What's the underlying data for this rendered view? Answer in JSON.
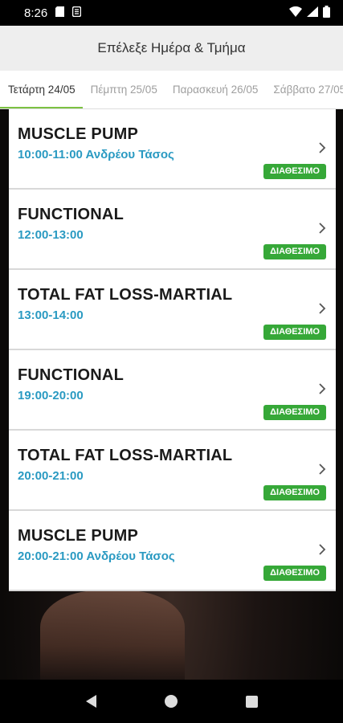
{
  "status_bar": {
    "time": "8:26",
    "icons": [
      "sd-card-icon",
      "sync-icon",
      "wifi-icon",
      "signal-icon",
      "battery-icon"
    ]
  },
  "header": {
    "title": "Επέλεξε Ημέρα & Τμήμα"
  },
  "tabs": [
    {
      "label": "Τετάρτη 24/05",
      "active": true
    },
    {
      "label": "Πέμπτη 25/05",
      "active": false
    },
    {
      "label": "Παρασκευή 26/05",
      "active": false
    },
    {
      "label": "Σάββατο 27/05",
      "active": false
    }
  ],
  "classes": [
    {
      "title": "MUSCLE PUMP",
      "details": "10:00-11:00 Ανδρέου Τάσος",
      "status": "ΔΙΑΘΕΣΙΜΟ"
    },
    {
      "title": "FUNCTIONAL",
      "details": "12:00-13:00",
      "status": "ΔΙΑΘΕΣΙΜΟ"
    },
    {
      "title": "TOTAL FAT LOSS-MARTIAL",
      "details": "13:00-14:00",
      "status": "ΔΙΑΘΕΣΙΜΟ"
    },
    {
      "title": "FUNCTIONAL",
      "details": "19:00-20:00",
      "status": "ΔΙΑΘΕΣΙΜΟ"
    },
    {
      "title": "TOTAL FAT LOSS-MARTIAL",
      "details": "20:00-21:00",
      "status": "ΔΙΑΘΕΣΙΜΟ"
    },
    {
      "title": "MUSCLE PUMP",
      "details": "20:00-21:00 Ανδρέου Τάσος",
      "status": "ΔΙΑΘΕΣΙΜΟ"
    }
  ],
  "colors": {
    "accent_green": "#7cc142",
    "badge_green": "#36a838",
    "time_blue": "#2a9ac2"
  }
}
